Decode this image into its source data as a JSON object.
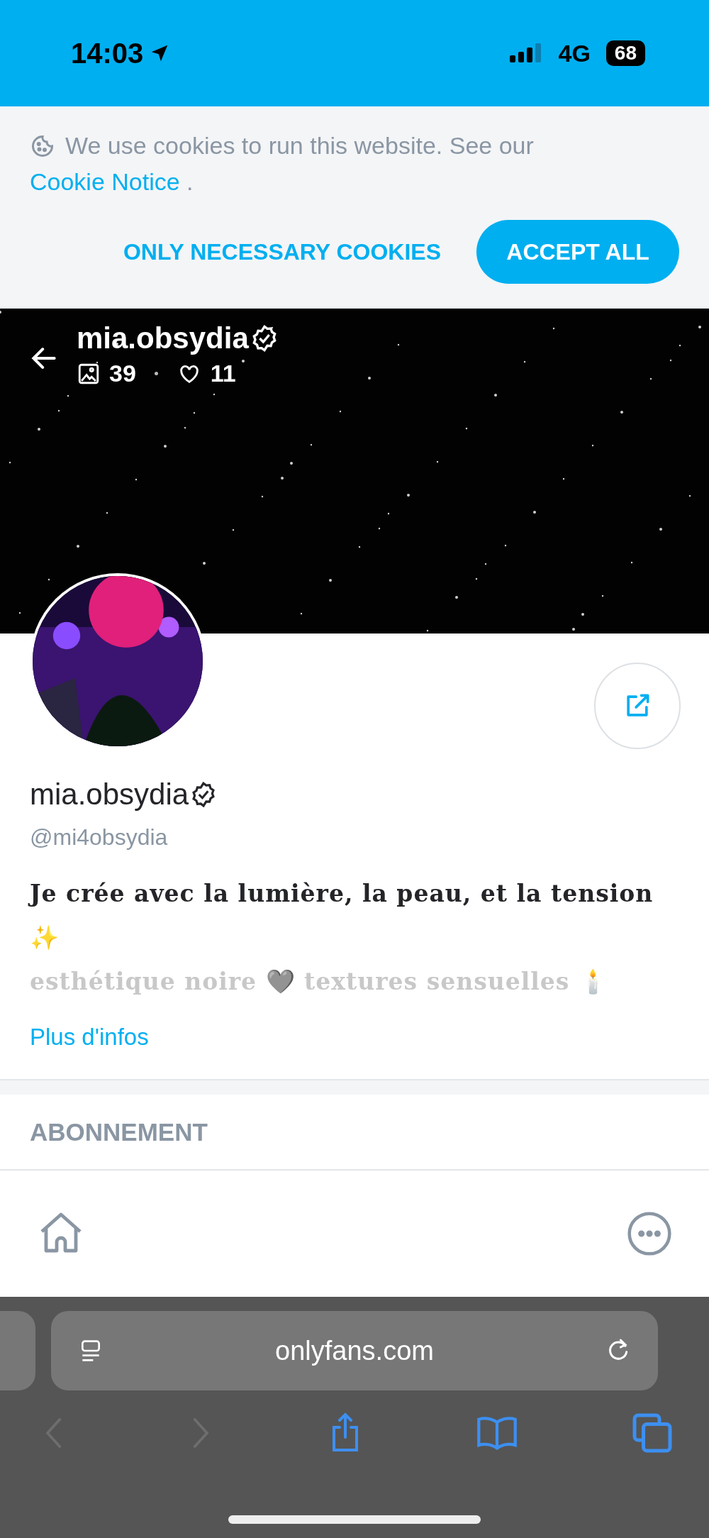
{
  "status_bar": {
    "time": "14:03",
    "network": "4G",
    "battery": "68"
  },
  "cookie_banner": {
    "text": "We use cookies to run this website. See our",
    "link": "Cookie Notice",
    "after": ".",
    "buttons": [
      {
        "label": "ONLY NECESSARY COOKIES",
        "kind": "text"
      },
      {
        "label": "ACCEPT ALL",
        "kind": "filled"
      }
    ]
  },
  "header": {
    "name": "mia.obsydia",
    "verified": true,
    "media_count": "39",
    "likes_count": "11"
  },
  "profile": {
    "name": "mia.obsydia",
    "verified": true,
    "handle": "@mi4obsydia",
    "bio": [
      "Je crée avec la lumière, la peau, et la tension ✨",
      "esthétique noire 🩶 textures sensuelles 🕯️"
    ],
    "more_link": "Plus d'infos"
  },
  "section": {
    "title": "ABONNEMENT"
  },
  "browser": {
    "url": "onlyfans.com"
  }
}
